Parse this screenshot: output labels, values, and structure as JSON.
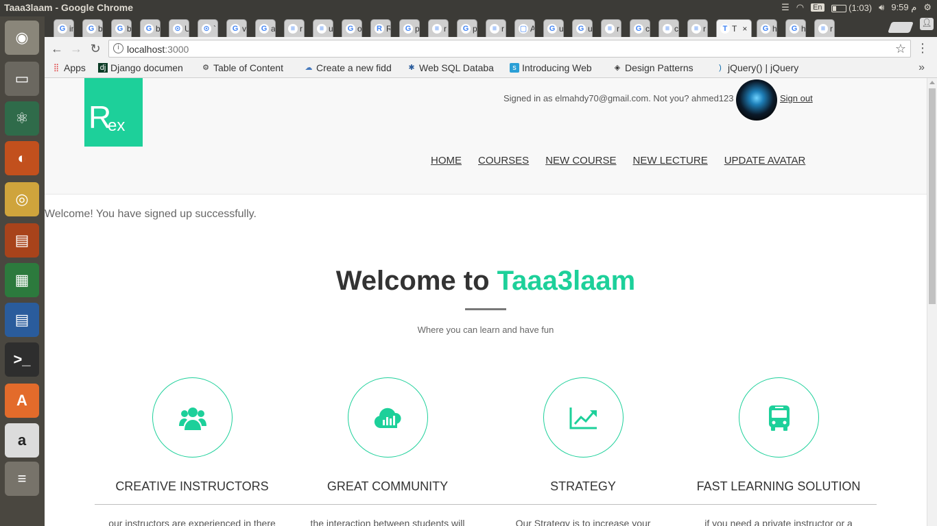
{
  "window": {
    "title": "Taaa3laam - Google Chrome",
    "tray": {
      "keyboard": "En",
      "battery": "(1:03)",
      "time": "9:59",
      "period": "م"
    }
  },
  "launcher": {
    "apps": [
      "ubuntu-dash-icon",
      "files-icon",
      "atom-icon",
      "firefox-icon",
      "chrome-icon",
      "impress-icon",
      "calc-icon",
      "writer-icon",
      "terminal-icon",
      "software-center-icon",
      "amazon-icon",
      "stack-icon"
    ]
  },
  "tabs": [
    {
      "fav": "G",
      "label": "in"
    },
    {
      "fav": "G",
      "label": "b"
    },
    {
      "fav": "G",
      "label": "b"
    },
    {
      "fav": "G",
      "label": "b"
    },
    {
      "fav": "⊙",
      "label": "U"
    },
    {
      "fav": "⊙",
      "label": "`"
    },
    {
      "fav": "G",
      "label": "v"
    },
    {
      "fav": "G",
      "label": "a"
    },
    {
      "fav": "≡",
      "label": "r"
    },
    {
      "fav": "≡",
      "label": "u"
    },
    {
      "fav": "G",
      "label": "o"
    },
    {
      "fav": "R",
      "label": "R"
    },
    {
      "fav": "G",
      "label": "p"
    },
    {
      "fav": "≡",
      "label": "r"
    },
    {
      "fav": "G",
      "label": "p"
    },
    {
      "fav": "≡",
      "label": "r"
    },
    {
      "fav": "▢",
      "label": "A"
    },
    {
      "fav": "G",
      "label": "u"
    },
    {
      "fav": "G",
      "label": "u"
    },
    {
      "fav": "≡",
      "label": "r"
    },
    {
      "fav": "G",
      "label": "c"
    },
    {
      "fav": "≡",
      "label": "c"
    },
    {
      "fav": "≡",
      "label": "r"
    },
    {
      "fav": "T",
      "label": "T"
    },
    {
      "fav": "G",
      "label": "h"
    },
    {
      "fav": "G",
      "label": "h"
    },
    {
      "fav": "≡",
      "label": "r"
    }
  ],
  "active_tab_close": "×",
  "address_bar": {
    "host": "localhost",
    "port": ":3000"
  },
  "bookmarks": [
    {
      "icon": "apps-icon",
      "label": "Apps"
    },
    {
      "icon": "django-icon",
      "label": "Django documen"
    },
    {
      "icon": "toc-icon",
      "label": "Table of Content"
    },
    {
      "icon": "jsfiddle-icon",
      "label": "Create a new fidd"
    },
    {
      "icon": "websql-icon",
      "label": "Web SQL Databa"
    },
    {
      "icon": "site-icon",
      "label": "Introducing Web"
    },
    {
      "icon": "patterns-icon",
      "label": "Design Patterns"
    },
    {
      "icon": "jquery-icon",
      "label": "jQuery() | jQuery"
    }
  ],
  "site": {
    "logo_big": "R",
    "logo_small": "ex",
    "signed_in": "Signed in as elmahdy70@gmail.com. Not you? ahmed123",
    "sign_out": "Sign out",
    "nav": [
      "HOME",
      "COURSES",
      "NEW COURSE",
      "NEW LECTURE",
      "UPDATE AVATAR"
    ],
    "flash": "Welcome! You have signed up successfully.",
    "hero": {
      "title_prefix": "Welcome to ",
      "title_accent": "Taaa3laam",
      "subtitle": "Where you can learn and have fun"
    },
    "accent_color": "#1dd09a",
    "features": [
      {
        "icon": "users-icon",
        "title": "CREATIVE INSTRUCTORS",
        "desc": "our instructors are experienced in there"
      },
      {
        "icon": "cloud-icon",
        "title": "GREAT COMMUNITY",
        "desc": "the interaction between students will"
      },
      {
        "icon": "chart-icon",
        "title": "STRATEGY",
        "desc": "Our Strategy is to increase your"
      },
      {
        "icon": "bus-icon",
        "title": "FAST LEARNING SOLUTION",
        "desc": "if you need a private instructor or a"
      }
    ]
  }
}
